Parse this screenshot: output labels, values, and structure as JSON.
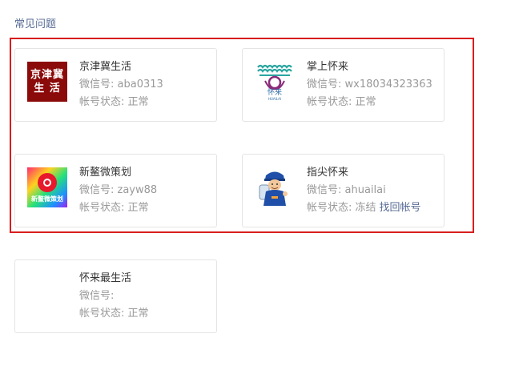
{
  "section": {
    "title": "常见问题"
  },
  "labels": {
    "wechat_id_prefix": "微信号:",
    "status_prefix": "帐号状态:"
  },
  "accounts": [
    {
      "name": "京津冀生活",
      "wechat_id": "微信号: aba0313",
      "status": "帐号状态: 正常",
      "avatar_icon": "jingjinji-logo",
      "avatar_text_1": "京津冀",
      "avatar_text_2": "生 活"
    },
    {
      "name": "掌上怀来",
      "wechat_id": "微信号: wx18034323363",
      "status": "帐号状态: 正常",
      "avatar_icon": "huailai-logo",
      "avatar_text_1": "怀来",
      "avatar_text_2": "HUAILAI"
    },
    {
      "name": "新鳌微策划",
      "wechat_id": "微信号: zayw88",
      "status": "帐号状态: 正常",
      "avatar_icon": "xinao-logo",
      "avatar_text_1": "新鳌微策划"
    },
    {
      "name": "指尖怀来",
      "wechat_id": "微信号: ahuailai",
      "status": "帐号状态: 冻结",
      "recover_label": "找回帐号",
      "avatar_icon": "worker-mascot-logo"
    },
    {
      "name": "怀来最生活",
      "wechat_id": "微信号:",
      "status": "帐号状态: 正常",
      "avatar_icon": "none"
    }
  ],
  "colors": {
    "highlight_border": "#d81e1e",
    "link": "#576b95",
    "muted_text": "#999999",
    "card_border": "#e4e4e4"
  }
}
